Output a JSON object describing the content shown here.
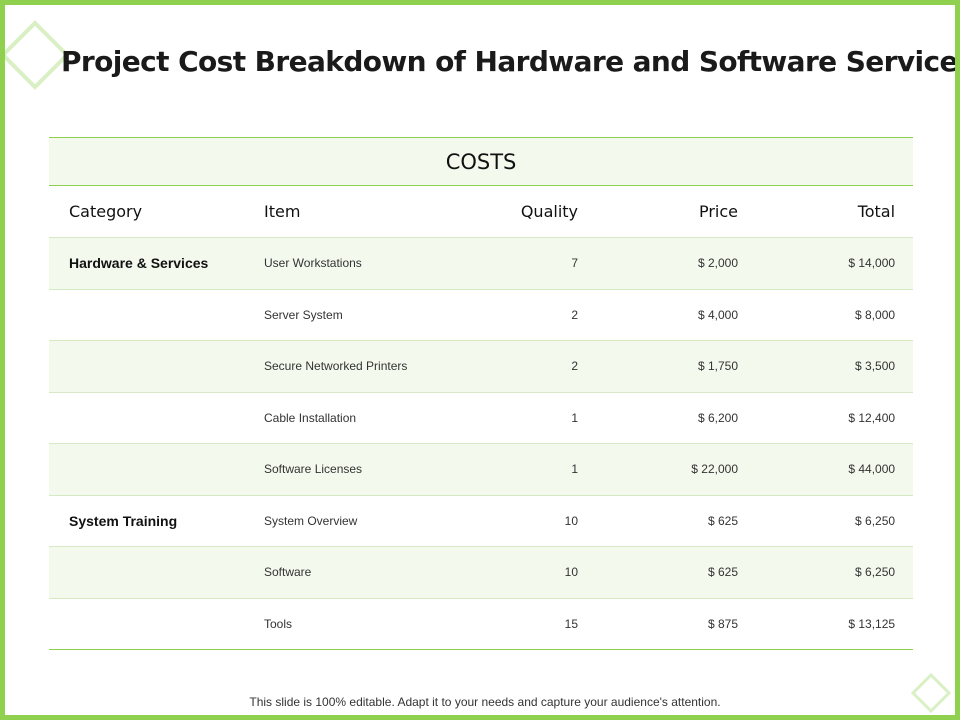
{
  "title": "Project Cost Breakdown of Hardware and Software Service",
  "table": {
    "caption": "COSTS",
    "columns": [
      "Category",
      "Item",
      "Quality",
      "Price",
      "Total"
    ],
    "rows": [
      {
        "category": "Hardware & Services",
        "item": "User Workstations",
        "quality": "7",
        "price": "$ 2,000",
        "total": "$ 14,000"
      },
      {
        "category": "",
        "item": "Server System",
        "quality": "2",
        "price": "$ 4,000",
        "total": "$ 8,000"
      },
      {
        "category": "",
        "item": "Secure Networked Printers",
        "quality": "2",
        "price": "$ 1,750",
        "total": "$ 3,500"
      },
      {
        "category": "",
        "item": "Cable Installation",
        "quality": "1",
        "price": "$ 6,200",
        "total": "$ 12,400"
      },
      {
        "category": "",
        "item": "Software Licenses",
        "quality": "1",
        "price": "$ 22,000",
        "total": "$ 44,000"
      },
      {
        "category": "System Training",
        "item": "System Overview",
        "quality": "10",
        "price": "$ 625",
        "total": "$ 6,250"
      },
      {
        "category": "",
        "item": "Software",
        "quality": "10",
        "price": "$ 625",
        "total": "$ 6,250"
      },
      {
        "category": "",
        "item": "Tools",
        "quality": "15",
        "price": "$ 875",
        "total": "$ 13,125"
      }
    ]
  },
  "footer": "This slide is 100% editable. Adapt it to your needs and capture your audience's attention.",
  "colors": {
    "accent": "#8fd14f",
    "row_shade": "#f4f9ee"
  }
}
